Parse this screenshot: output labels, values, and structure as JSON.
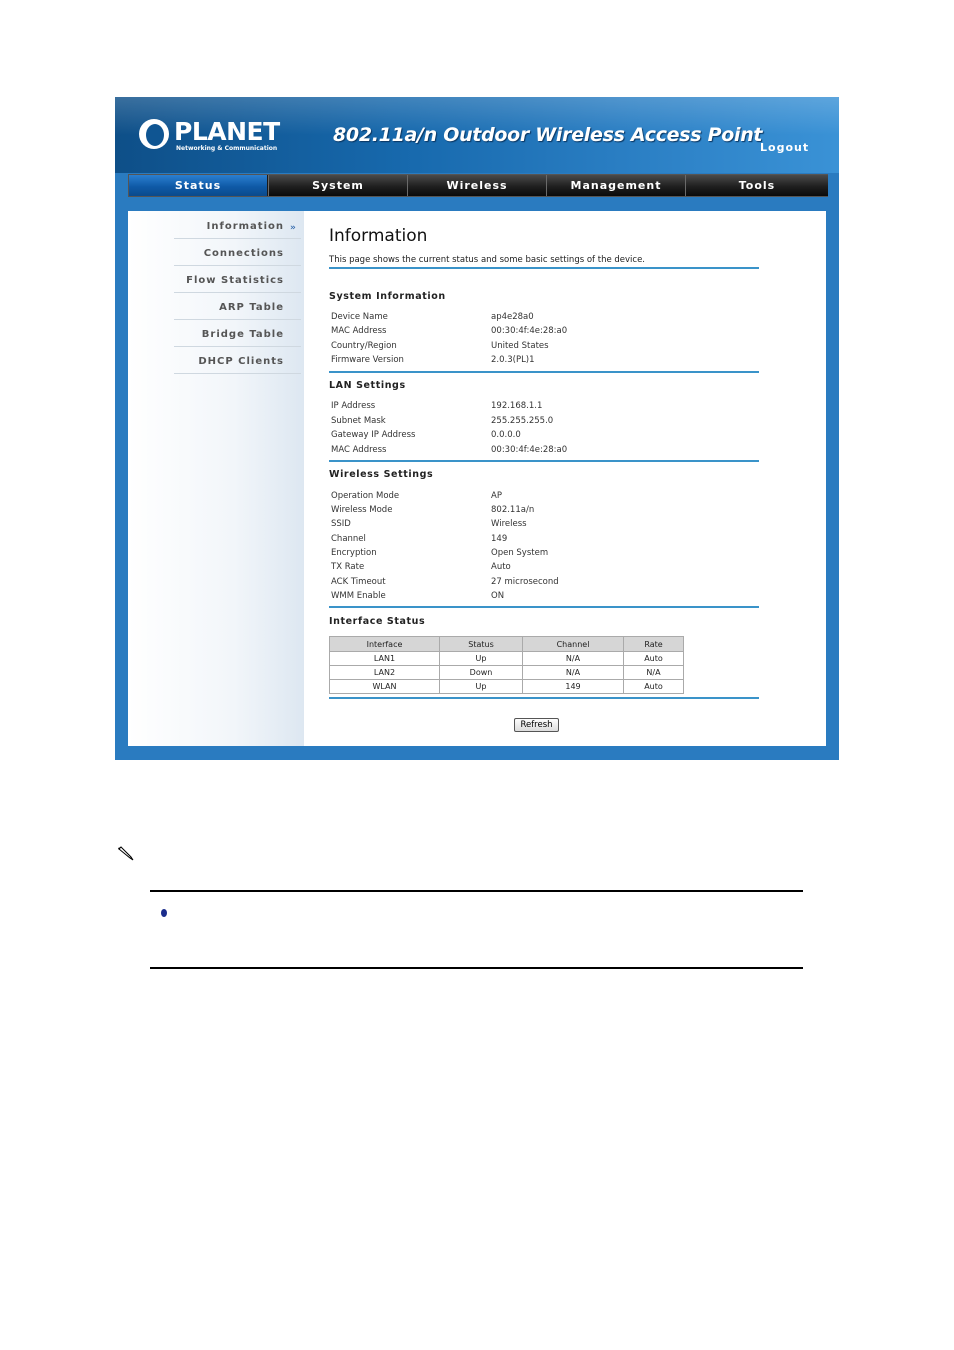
{
  "header": {
    "brand": "PLANET",
    "brand_tagline": "Networking & Communication",
    "title": "802.11a/n Outdoor Wireless Access Point",
    "logout_label": "Logout"
  },
  "nav": {
    "tabs": [
      {
        "label": "Status",
        "active": true
      },
      {
        "label": "System"
      },
      {
        "label": "Wireless"
      },
      {
        "label": "Management"
      },
      {
        "label": "Tools"
      }
    ]
  },
  "sidebar": {
    "items": [
      {
        "label": "Information",
        "active": true
      },
      {
        "label": "Connections"
      },
      {
        "label": "Flow Statistics"
      },
      {
        "label": "ARP Table"
      },
      {
        "label": "Bridge Table"
      },
      {
        "label": "DHCP Clients"
      }
    ],
    "active_marker": "»"
  },
  "page": {
    "title": "Information",
    "description": "This page shows the current status and some basic settings of the device."
  },
  "system_info": {
    "heading": "System Information",
    "rows": [
      {
        "label": "Device Name",
        "value": "ap4e28a0"
      },
      {
        "label": "MAC Address",
        "value": "00:30:4f:4e:28:a0"
      },
      {
        "label": "Country/Region",
        "value": "United States"
      },
      {
        "label": "Firmware Version",
        "value": "2.0.3(PL)1"
      }
    ]
  },
  "lan_settings": {
    "heading": "LAN Settings",
    "rows": [
      {
        "label": "IP Address",
        "value": "192.168.1.1"
      },
      {
        "label": "Subnet Mask",
        "value": "255.255.255.0"
      },
      {
        "label": "Gateway IP Address",
        "value": "0.0.0.0"
      },
      {
        "label": "MAC Address",
        "value": "00:30:4f:4e:28:a0"
      }
    ]
  },
  "wireless_settings": {
    "heading": "Wireless Settings",
    "rows": [
      {
        "label": "Operation Mode",
        "value": "AP"
      },
      {
        "label": "Wireless Mode",
        "value": "802.11a/n"
      },
      {
        "label": "SSID",
        "value": "Wireless"
      },
      {
        "label": "Channel",
        "value": "149"
      },
      {
        "label": "Encryption",
        "value": "Open System"
      },
      {
        "label": "TX Rate",
        "value": "Auto"
      },
      {
        "label": "ACK Timeout",
        "value": "27   microsecond"
      },
      {
        "label": "WMM Enable",
        "value": "ON"
      }
    ]
  },
  "interface_status": {
    "heading": "Interface Status",
    "columns": [
      "Interface",
      "Status",
      "Channel",
      "Rate"
    ],
    "rows": [
      [
        "LAN1",
        "Up",
        "N/A",
        "Auto"
      ],
      [
        "LAN2",
        "Down",
        "N/A",
        "N/A"
      ],
      [
        "WLAN",
        "Up",
        "149",
        "Auto"
      ]
    ]
  },
  "buttons": {
    "refresh_label": "Refresh"
  },
  "colors": {
    "header_blue": "#1769ad",
    "rule_blue": "#3a93c9",
    "nav_active": "#0f5aa7"
  },
  "icons": {
    "note": "pencil-icon",
    "bullet": "bullet-icon"
  }
}
